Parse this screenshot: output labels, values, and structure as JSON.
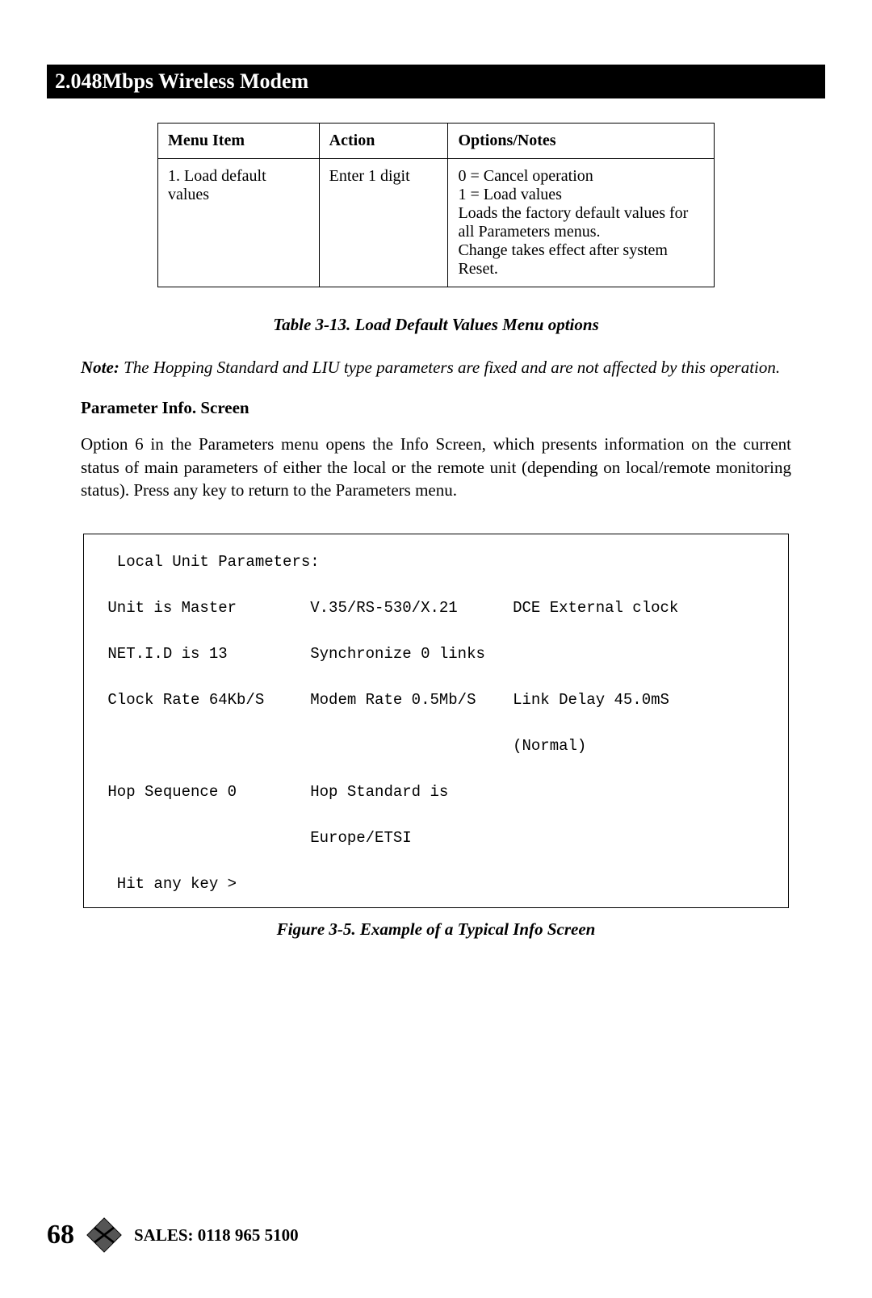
{
  "header": {
    "title": "2.048Mbps Wireless Modem"
  },
  "table": {
    "headers": {
      "c1": "Menu Item",
      "c2": "Action",
      "c3": "Options/Notes"
    },
    "row1": {
      "c1": "1. Load default values",
      "c2": "Enter 1 digit",
      "c3": "0 = Cancel operation\n1 = Load values\nLoads the factory default values for all Parameters menus.\nChange takes effect after system Reset."
    },
    "caption": "Table 3-13. Load Default Values Menu options"
  },
  "note": {
    "label": "Note:",
    "body": " The Hopping Standard and LIU type parameters are fixed and are not affected by this operation."
  },
  "section": {
    "heading": "Parameter Info. Screen"
  },
  "para": {
    "body": "Option 6 in the Parameters menu opens the Info Screen, which presents information on the current status of main parameters of either the local or the  remote unit (depending on local/remote monitoring status). Press any key to return to the Parameters menu."
  },
  "chart_data": {
    "type": "table",
    "title": "Local Unit Parameters",
    "rows": [
      [
        "Unit is Master",
        "V.35/RS-530/X.21",
        "DCE External clock"
      ],
      [
        "NET.I.D is 13",
        "Synchronize 0 links",
        ""
      ],
      [
        "Clock Rate 64Kb/S",
        "Modem Rate 0.5Mb/S",
        "Link Delay 45.0mS (Normal)"
      ],
      [
        "Hop Sequence 0",
        "Hop Standard is Europe/ETSI",
        ""
      ]
    ],
    "prompt": "Hit any key >"
  },
  "info_screen": {
    "title_line": "  Local Unit Parameters:",
    "r1": " Unit is Master        V.35/RS-530/X.21      DCE External clock",
    "r2": " NET.I.D is 13         Synchronize 0 links",
    "r3": " Clock Rate 64Kb/S     Modem Rate 0.5Mb/S    Link Delay 45.0mS",
    "r3b": "                                             (Normal)",
    "r4": " Hop Sequence 0        Hop Standard is",
    "r4b": "                       Europe/ETSI",
    "prompt": "  Hit any key >"
  },
  "figure": {
    "caption": "Figure 3-5. Example of a Typical Info Screen"
  },
  "footer": {
    "page": "68",
    "sales": "SALES: 0118 965 5100"
  }
}
